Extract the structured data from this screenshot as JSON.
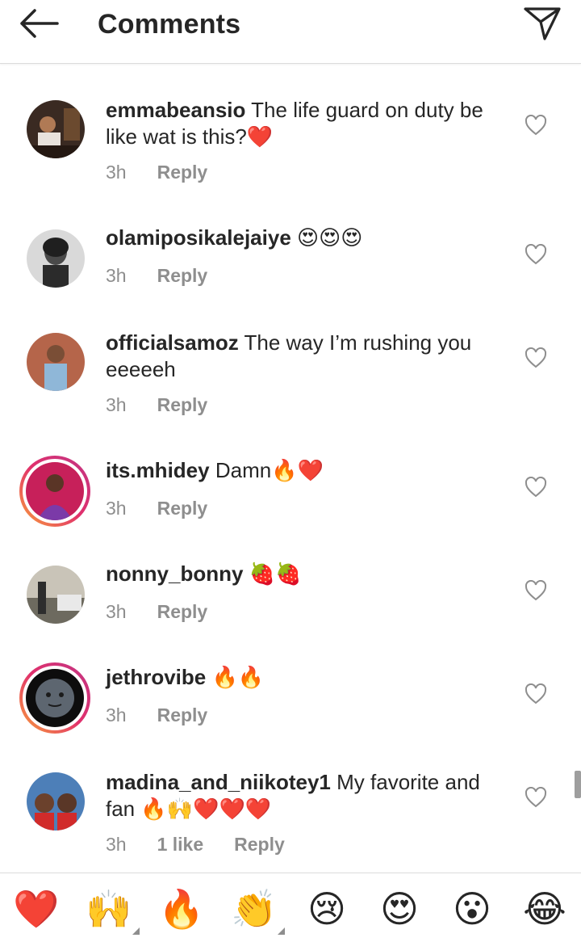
{
  "header": {
    "title": "Comments",
    "back_icon": "arrow-left-icon",
    "send_icon": "paper-plane-icon"
  },
  "comments": [
    {
      "username": "emmabeansio",
      "text": "The life guard  on duty be like wat is this?❤️",
      "time": "3h",
      "likes": "",
      "reply": "Reply"
    },
    {
      "username": "olamiposikalejaiye",
      "text": "😍😍😍",
      "time": "3h",
      "likes": "",
      "reply": "Reply"
    },
    {
      "username": "officialsamoz",
      "text": "The way I’m rushing you eeeeeh",
      "time": "3h",
      "likes": "",
      "reply": "Reply"
    },
    {
      "username": "its.mhidey",
      "text": "Damn🔥❤️",
      "time": "3h",
      "likes": "",
      "reply": "Reply"
    },
    {
      "username": "nonny_bonny",
      "text": "🍓🍓",
      "time": "3h",
      "likes": "",
      "reply": "Reply"
    },
    {
      "username": "jethrovibe",
      "text": "🔥🔥",
      "time": "3h",
      "likes": "",
      "reply": "Reply"
    },
    {
      "username": "madina_and_niikotey1",
      "text": "My favorite and fan 🔥🙌❤️❤️❤️",
      "time": "3h",
      "likes": "1 like",
      "reply": "Reply"
    }
  ],
  "emoji_bar": [
    "❤️",
    "🙌",
    "🔥",
    "👏",
    "😢",
    "😍",
    "😮",
    "😂"
  ],
  "colors": {
    "text": "#262626",
    "meta": "#8e8e8e",
    "divider": "#dbdbdb",
    "heart": "#ed4956"
  }
}
